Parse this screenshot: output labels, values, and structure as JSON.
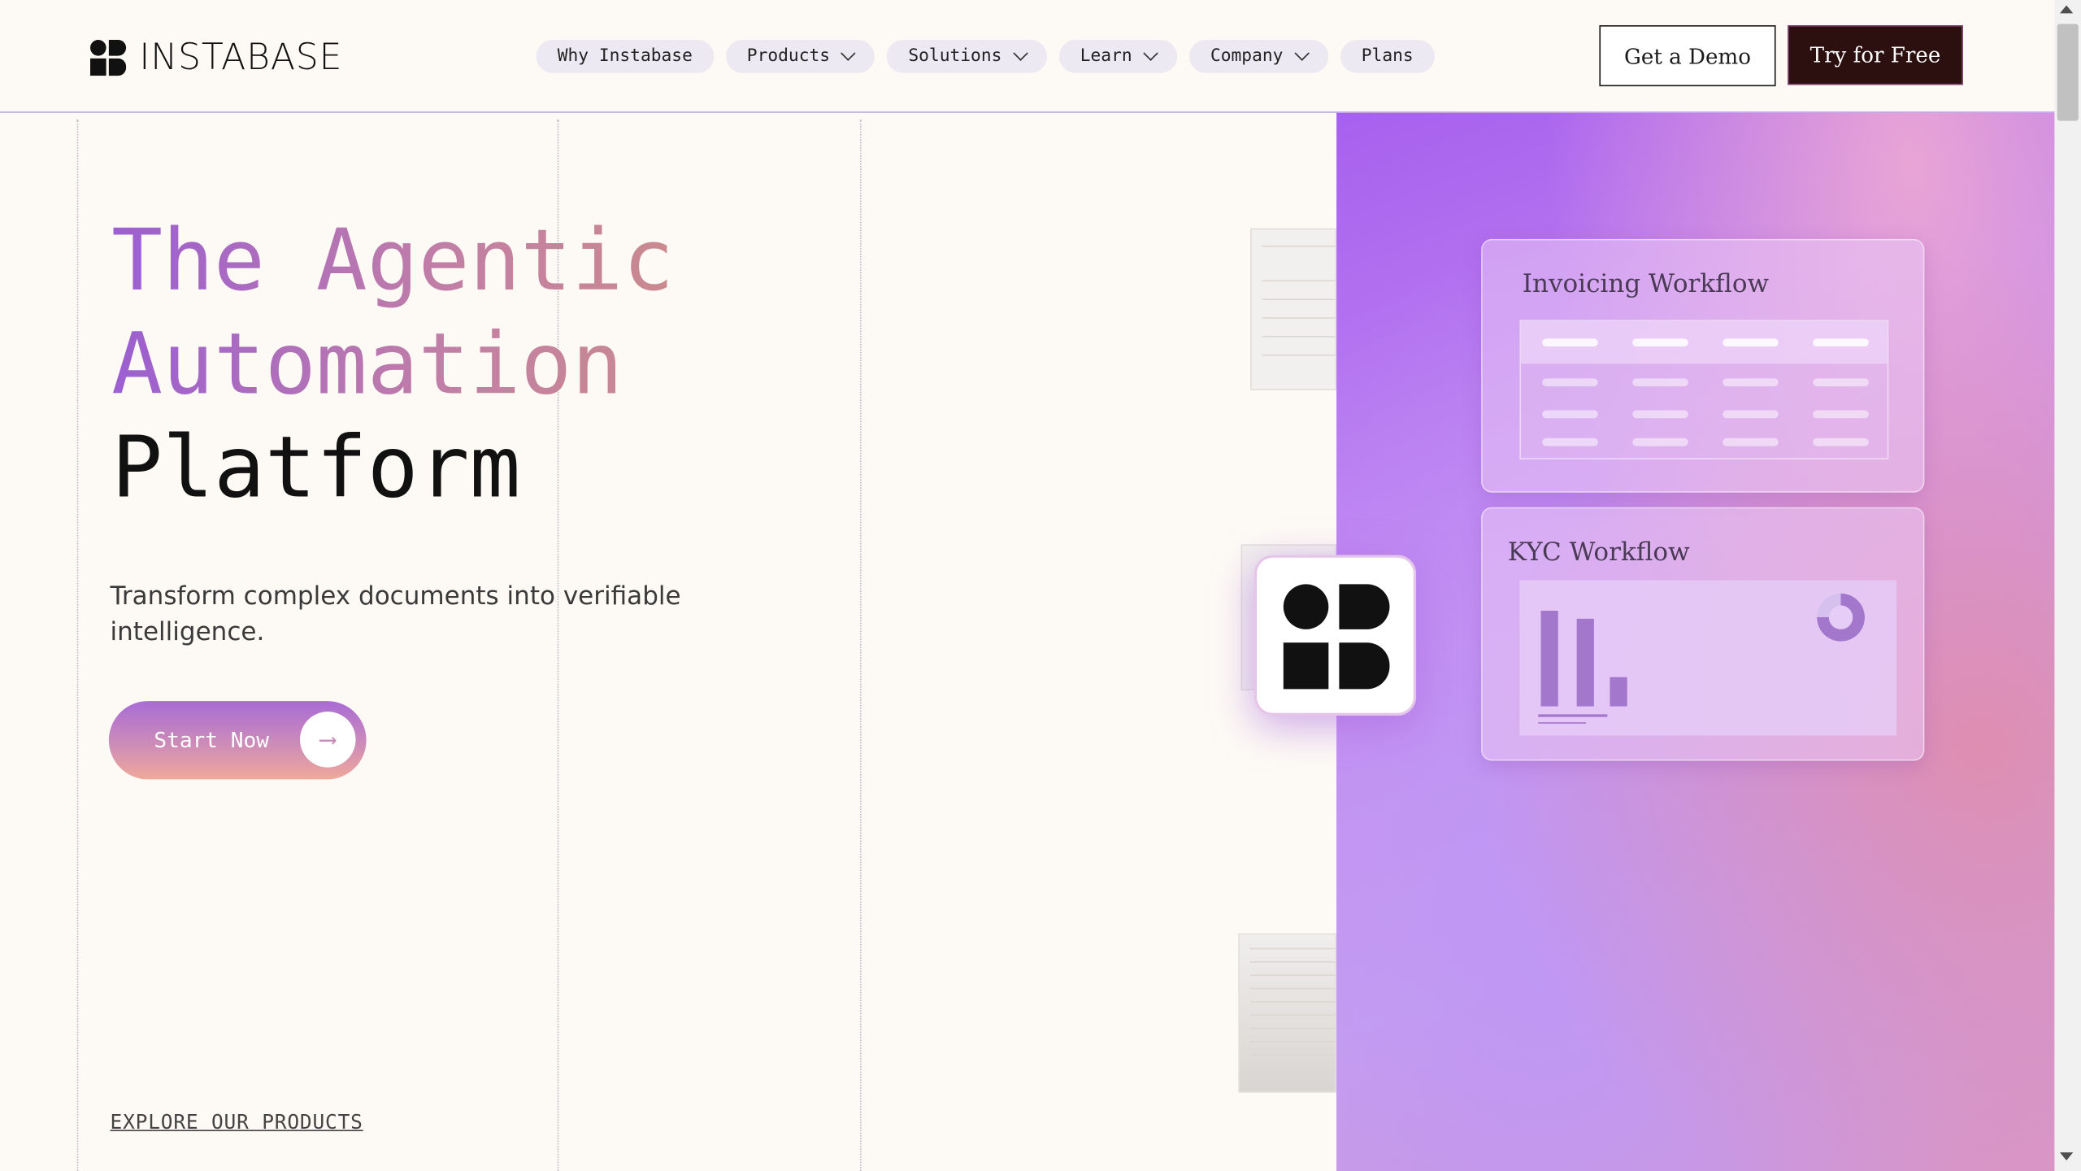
{
  "header": {
    "logo_text": "INSTABASE",
    "nav": [
      {
        "label": "Why Instabase",
        "dropdown": false
      },
      {
        "label": "Products",
        "dropdown": true
      },
      {
        "label": "Solutions",
        "dropdown": true
      },
      {
        "label": "Learn",
        "dropdown": true
      },
      {
        "label": "Company",
        "dropdown": true
      },
      {
        "label": "Plans",
        "dropdown": false
      }
    ],
    "demo_label": "Get a Demo",
    "try_label": "Try for Free"
  },
  "hero": {
    "title_line1": "The Agentic",
    "title_line2": "Automation",
    "title_line3": "Platform",
    "subtitle": "Transform complex documents into verifiable intelligence.",
    "cta_label": "Start Now",
    "cta_icon": "arrow-right-icon",
    "explore_label": "EXPLORE OUR PRODUCTS"
  },
  "visual": {
    "card1_title": "Invoicing Workflow",
    "card2_title": "KYC Workflow"
  },
  "colors": {
    "background": "#fdfaf5",
    "accent_dark": "#2c0f0f",
    "gradient_purple": "#a760ee",
    "gradient_pink": "#d796c8"
  }
}
